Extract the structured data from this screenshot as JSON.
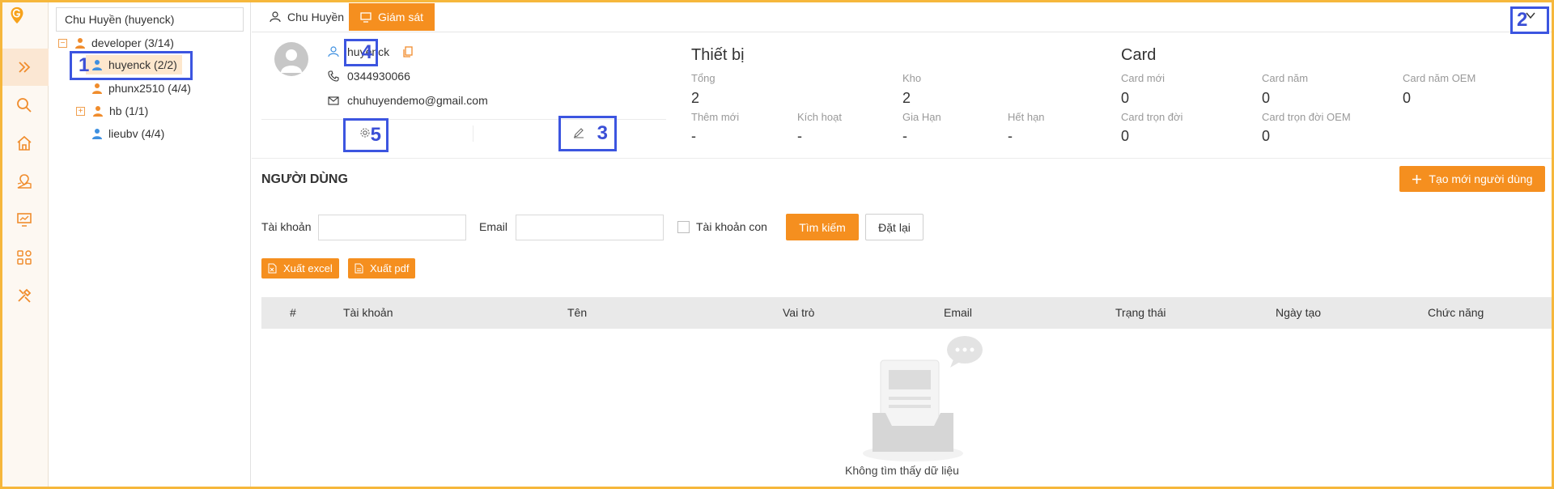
{
  "sidebar": {
    "items": [
      {
        "icon": "chevrons-right-icon"
      },
      {
        "icon": "search-icon"
      },
      {
        "icon": "home-icon"
      },
      {
        "icon": "map-pin-icon"
      },
      {
        "icon": "monitor-chart-icon"
      },
      {
        "icon": "grid-icon"
      },
      {
        "icon": "tools-icon"
      }
    ]
  },
  "tree": {
    "search_value": "Chu Huyền (huyenck)",
    "nodes": [
      {
        "label": "developer (3/14)",
        "toggle": "−"
      },
      {
        "label": "huyenck (2/2)"
      },
      {
        "label": "phunx2510 (4/4)"
      },
      {
        "label": "hb (1/1)",
        "toggle": "+"
      },
      {
        "label": "lieubv (4/4)"
      }
    ]
  },
  "tabs": {
    "user": "Chu Huyền",
    "monitor": "Giám sát"
  },
  "profile": {
    "username": "huyenck",
    "phone": "0344930066",
    "email": "chuhuyendemo@gmail.com"
  },
  "devices": {
    "title": "Thiết bị",
    "total_label": "Tổng",
    "total_value": "2",
    "stock_label": "Kho",
    "stock_value": "2",
    "new_label": "Thêm mới",
    "new_value": "-",
    "active_label": "Kích hoạt",
    "active_value": "-",
    "renew_label": "Gia Hạn",
    "renew_value": "-",
    "expired_label": "Hết hạn",
    "expired_value": "-"
  },
  "cards": {
    "title": "Card",
    "new_label": "Card mới",
    "new_value": "0",
    "year_label": "Card năm",
    "year_value": "0",
    "year_oem_label": "Card năm OEM",
    "year_oem_value": "0",
    "lifetime_label": "Card trọn đời",
    "lifetime_value": "0",
    "lifetime_oem_label": "Card trọn đời OEM",
    "lifetime_oem_value": "0"
  },
  "users_section": {
    "title": "NGƯỜI DÙNG",
    "create_button": "Tạo mới người dùng",
    "filters": {
      "account_label": "Tài khoản",
      "account_value": "",
      "email_label": "Email",
      "email_value": "",
      "child_label": "Tài khoản con",
      "search_button": "Tìm kiếm",
      "reset_button": "Đặt lại"
    },
    "export_excel": "Xuất excel",
    "export_pdf": "Xuất pdf",
    "columns": [
      "#",
      "Tài khoản",
      "Tên",
      "Vai trò",
      "Email",
      "Trạng thái",
      "Ngày tạo",
      "Chức năng"
    ],
    "rows": [],
    "empty_text": "Không tìm thấy dữ liệu"
  },
  "annotations": {
    "b1": "1",
    "b2": "2",
    "b3": "3",
    "b4": "4",
    "b5": "5"
  },
  "colors": {
    "accent": "#f58f1f",
    "annotation": "#3c55e0",
    "user_icon": "#3d8fe0",
    "group_icon": "#f08c2c"
  }
}
